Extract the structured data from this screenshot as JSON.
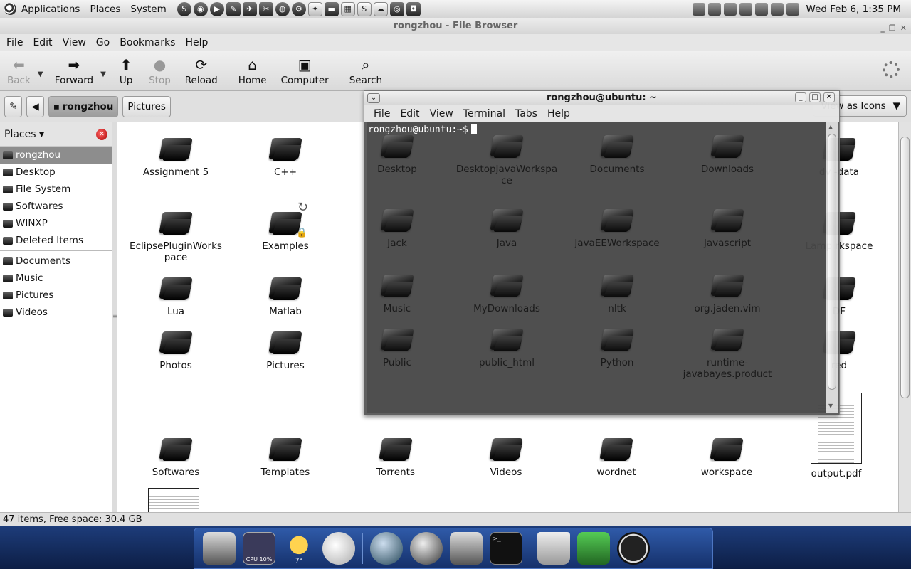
{
  "top_panel": {
    "menus": [
      "Applications",
      "Places",
      "System"
    ],
    "clock": "Wed Feb  6,  1:35 PM"
  },
  "file_browser": {
    "title": "rongzhou - File Browser",
    "menubar": [
      "File",
      "Edit",
      "View",
      "Go",
      "Bookmarks",
      "Help"
    ],
    "toolbar": {
      "back": "Back",
      "forward": "Forward",
      "up": "Up",
      "stop": "Stop",
      "reload": "Reload",
      "home": "Home",
      "computer": "Computer",
      "search": "Search"
    },
    "location": {
      "current": "rongzhou",
      "next": "Pictures",
      "view_as": "View as Icons"
    },
    "sidebar": {
      "header": "Places",
      "items": [
        "rongzhou",
        "Desktop",
        "File System",
        "Softwares",
        "WINXP",
        "Deleted Items"
      ],
      "bookmarks": [
        "Documents",
        "Music",
        "Pictures",
        "Videos"
      ]
    },
    "files": {
      "assignment5": "Assignment 5",
      "cpp": "C++",
      "eclipse": "EclipsePluginWorkspace",
      "examples": "Examples",
      "lua": "Lua",
      "matlab": "Matlab",
      "photos": "Photos",
      "pictures": "Pictures",
      "softwares": "Softwares",
      "templates": "Templates",
      "torrents": "Torrents",
      "videos": "Videos",
      "wordnet": "wordnet",
      "workspace": "workspace",
      "output_pdf": "output.pdf",
      "right_col_1": "dv   -data",
      "right_col_2": "Lamp   rkspace",
      "right_col_3": "DF",
      "right_col_4": "red"
    },
    "status": "47 items, Free space: 30.4 GB"
  },
  "terminal": {
    "title": "rongzhou@ubuntu: ~",
    "menubar": [
      "File",
      "Edit",
      "View",
      "Terminal",
      "Tabs",
      "Help"
    ],
    "prompt": "rongzhou@ubuntu:~$",
    "files": {
      "desktop": "Desktop",
      "djw": "DesktopJavaWorkspace",
      "documents": "Documents",
      "downloads": "Downloads",
      "jack": "Jack",
      "java": "Java",
      "jee": "JavaEEWorkspace",
      "javascript": "Javascript",
      "music": "Music",
      "mydownloads": "MyDownloads",
      "nltk": "nltk",
      "jadenvim": "org.jaden.vim",
      "public": "Public",
      "public_html": "public_html",
      "python": "Python",
      "runtime": "runtime-javabayes.product"
    }
  },
  "dock": {
    "cpu_label": "CPU 10%",
    "weather_label": "7°"
  }
}
